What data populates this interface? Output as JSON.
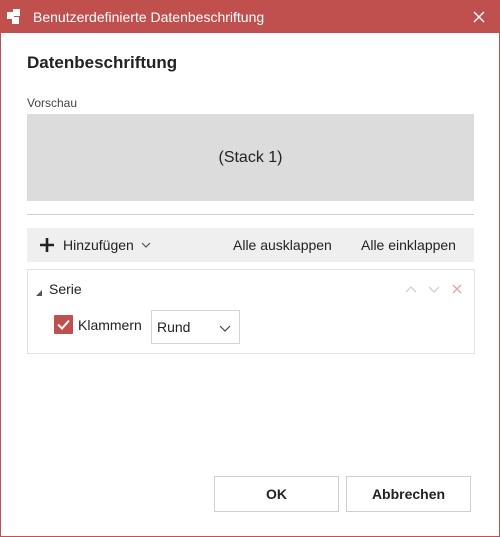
{
  "window": {
    "title": "Benutzerdefinierte Datenbeschriftung"
  },
  "dialog": {
    "heading": "Datenbeschriftung",
    "preview_label": "Vorschau",
    "preview_text": "(Stack 1)"
  },
  "toolbar": {
    "add_label": "Hinzufügen",
    "expand_all": "Alle ausklappen",
    "collapse_all": "Alle einklappen"
  },
  "item": {
    "label": "Serie",
    "option": {
      "checkbox_label": "Klammern",
      "checked": true,
      "select_value": "Rund"
    }
  },
  "footer": {
    "ok": "OK",
    "cancel": "Abbrechen"
  },
  "colors": {
    "accent": "#c0504d",
    "preview_bg": "#dcdcdc",
    "toolbar_bg": "#efefef"
  },
  "icons": [
    "app-icon",
    "close-icon",
    "plus-icon",
    "chevron-down-icon",
    "caret-icon",
    "move-up-icon",
    "move-down-icon",
    "delete-icon",
    "checkmark-icon"
  ]
}
